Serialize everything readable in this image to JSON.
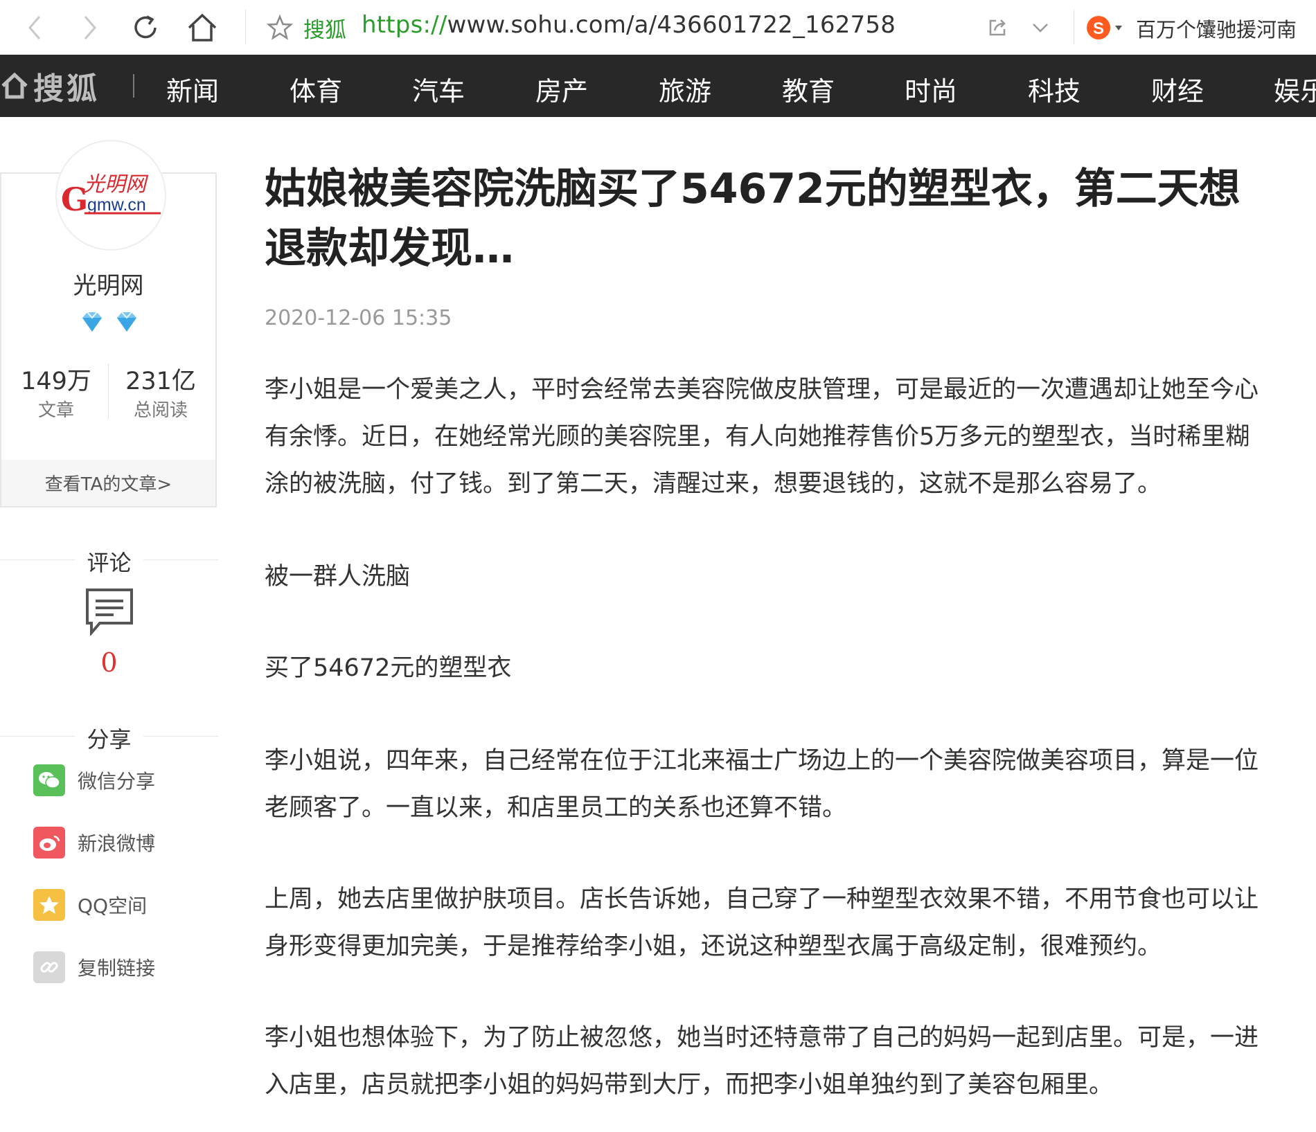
{
  "browser": {
    "site_label": "搜狐",
    "url_scheme": "https://",
    "url_rest": "www.sohu.com/a/436601722_162758",
    "search_text": "百万个馕驰援河南"
  },
  "nav": {
    "logo_text": "搜狐",
    "items": [
      "新闻",
      "体育",
      "汽车",
      "房产",
      "旅游",
      "教育",
      "时尚",
      "科技",
      "财经",
      "娱乐"
    ]
  },
  "author": {
    "logo_line1": "光明网",
    "logo_line2": "gmw.cn",
    "name": "光明网",
    "stats": [
      {
        "value": "149万",
        "label": "文章"
      },
      {
        "value": "231亿",
        "label": "总阅读"
      }
    ],
    "link": "查看TA的文章>"
  },
  "comments": {
    "title": "评论",
    "count": "0"
  },
  "share": {
    "title": "分享",
    "items": [
      {
        "label": "微信分享",
        "icon": "wechat-icon",
        "color": "#5ac05a"
      },
      {
        "label": "新浪微博",
        "icon": "weibo-icon",
        "color": "#f0575f"
      },
      {
        "label": "QQ空间",
        "icon": "qzone-icon",
        "color": "#f6c042"
      },
      {
        "label": "复制链接",
        "icon": "link-icon",
        "color": "#d8d8d8"
      }
    ]
  },
  "article": {
    "title": "姑娘被美容院洗脑买了54672元的塑型衣，第二天想退款却发现…",
    "time": "2020-12-06 15:35",
    "paragraphs": [
      "李小姐是一个爱美之人，平时会经常去美容院做皮肤管理，可是最近的一次遭遇却让她至今心有余悸。近日，在她经常光顾的美容院里，有人向她推荐售价5万多元的塑型衣，当时稀里糊涂的被洗脑，付了钱。到了第二天，清醒过来，想要退钱的，这就不是那么容易了。",
      "被一群人洗脑",
      "买了54672元的塑型衣",
      "李小姐说，四年来，自己经常在位于江北来福士广场边上的一个美容院做美容项目，算是一位老顾客了。一直以来，和店里员工的关系也还算不错。",
      "上周，她去店里做护肤项目。店长告诉她，自己穿了一种塑型衣效果不错，不用节食也可以让身形变得更加完美，于是推荐给李小姐，还说这种塑型衣属于高级定制，很难预约。",
      "李小姐也想体验下，为了防止被忽悠，她当时还特意带了自己的妈妈一起到店里。可是，一进入店里，店员就把李小姐的妈妈带到大厅，而把李小姐单独约到了美容包厢里。"
    ]
  }
}
